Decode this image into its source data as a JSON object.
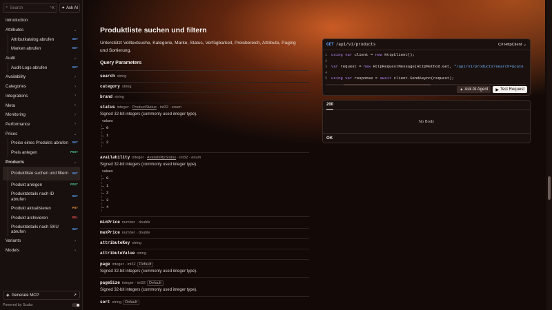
{
  "search": {
    "placeholder": "Search",
    "shortcut": "⌃K"
  },
  "ask_ai": "Ask AI",
  "nav": {
    "introduction": "Introduction",
    "attributes": "Attributes",
    "attr_1": "Attributkatalog abrufen",
    "attr_2": "Marken abrufen",
    "audit": "Audit",
    "audit_1": "Audit-Logs abrufen",
    "availability": "Availability",
    "categories": "Categories",
    "integrations": "Integrations",
    "meta": "Meta",
    "monitoring": "Monitoring",
    "performance": "Performance",
    "prices": "Prices",
    "prices_1": "Preise eines Produkts abrufen",
    "prices_2": "Preis anlegen",
    "products": "Products",
    "prod_1": "Produktliste suchen und filtern",
    "prod_2": "Produkt anlegen",
    "prod_3": "Produktdetails nach ID abrufen",
    "prod_4": "Produkt aktualisieren",
    "prod_5": "Produkt archivieren",
    "prod_6": "Produktdetails nach SKU abrufen",
    "variants": "Variants",
    "models": "Models",
    "badge_get": "GET",
    "badge_post": "POST",
    "badge_put": "PUT",
    "badge_del": "DEL"
  },
  "footer": {
    "generate_mcp": "Generate MCP",
    "powered": "Powered by Scalar"
  },
  "page": {
    "title": "Produktliste suchen und filtern",
    "description": "Unterstützt Volltextsuche, Kategorie, Marke, Status, Verfügbarkeit, Preisbereich, Attribute, Paging und Sortierung.",
    "query_params": "Query Parameters"
  },
  "params": {
    "search": {
      "name": "search",
      "type": "string"
    },
    "category": {
      "name": "category",
      "type": "string"
    },
    "brand": {
      "name": "brand",
      "type": "string"
    },
    "status": {
      "name": "status",
      "type": "integer",
      "ref": "ProductStatus",
      "extra": "int32 · enum",
      "desc": "Signed 32-bit integers (commonly used integer type).",
      "values_label": "values",
      "values": [
        "0",
        "1",
        "2"
      ]
    },
    "availability": {
      "name": "availability",
      "type": "integer",
      "ref": "AvailabilityStatus",
      "extra": "int32 · enum",
      "desc": "Signed 32-bit integers (commonly used integer type).",
      "values_label": "values",
      "values": [
        "0",
        "1",
        "2",
        "3",
        "4"
      ]
    },
    "minPrice": {
      "name": "minPrice",
      "type": "number · double"
    },
    "maxPrice": {
      "name": "maxPrice",
      "type": "number · double"
    },
    "attributeKey": {
      "name": "attributeKey",
      "type": "string"
    },
    "attributeValue": {
      "name": "attributeValue",
      "type": "string"
    },
    "page": {
      "name": "page",
      "type": "integer · int32",
      "default": "Default",
      "desc": "Signed 32-bit integers (commonly used integer type)."
    },
    "pageSize": {
      "name": "pageSize",
      "type": "integer · int32",
      "default": "Default",
      "desc": "Signed 32-bit integers (commonly used integer type)."
    },
    "sort": {
      "name": "sort",
      "type": "string",
      "default": "Default"
    }
  },
  "code": {
    "method": "GET",
    "path": "/api/v1/products",
    "client": "C# HttpClient",
    "lines": [
      {
        "no": "1",
        "kw": "using var",
        "rest": " client = ",
        "kw2": "new",
        "rest2": " HttpClient();"
      },
      {
        "no": "2"
      },
      {
        "no": "3",
        "kw": "var",
        "rest": " request = ",
        "kw2": "new",
        "rest2": " HttpRequestMessage(HttpMethod.Get, ",
        "str": "\"/api/v1/products?search=&cate"
      },
      {
        "no": "4"
      },
      {
        "no": "5",
        "kw": "using var",
        "rest": " response = ",
        "kw2": "await",
        "rest2": " client.SendAsync(request);"
      }
    ],
    "ask_agent": "Ask AI Agent",
    "test_request": "Test Request"
  },
  "response": {
    "tab": "200",
    "body": "No Body",
    "footer": "OK"
  },
  "colors": {
    "get": "#5b9cf5",
    "post": "#4cc38a",
    "put": "#f19042",
    "del": "#ef5252",
    "accent": "#e0662a"
  }
}
